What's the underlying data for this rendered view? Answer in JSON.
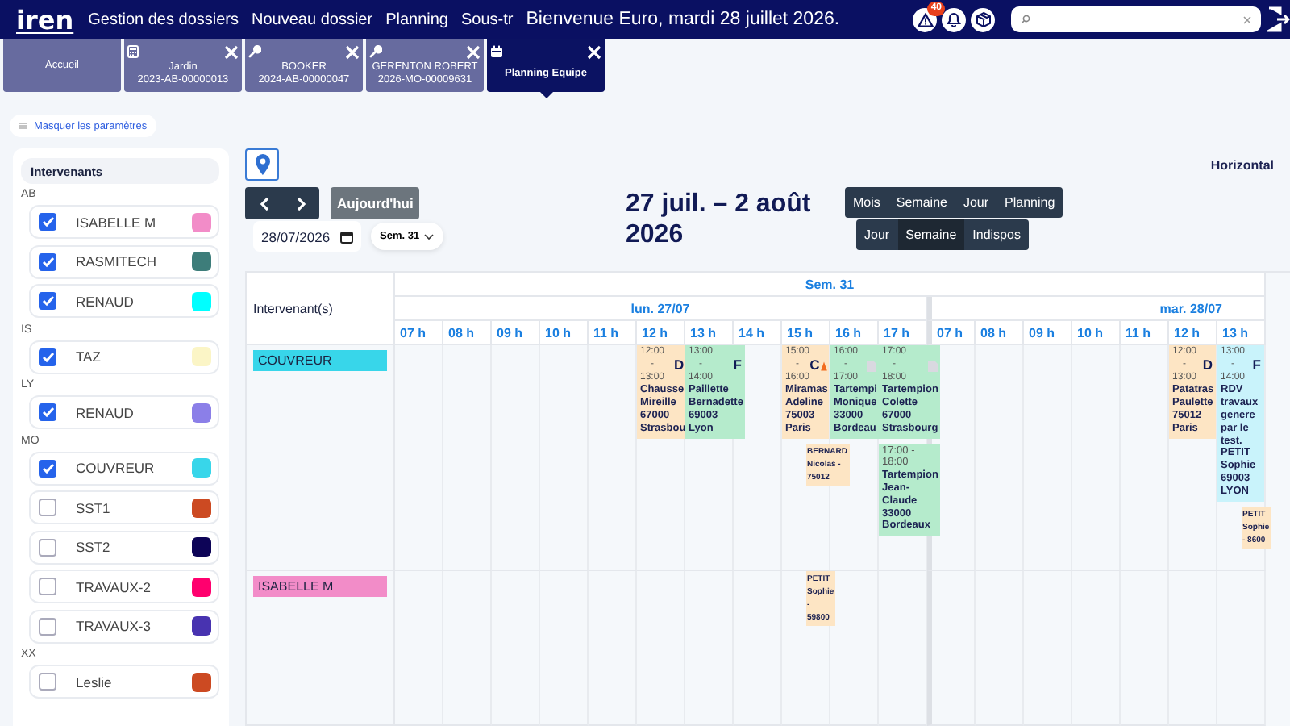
{
  "header": {
    "logo": "iren",
    "nav": [
      {
        "label": "Gestion des dossiers"
      },
      {
        "label": "Nouveau dossier"
      },
      {
        "label": "Planning"
      },
      {
        "label": "Sous-tr"
      }
    ],
    "welcome": "Bienvenue Euro, mardi 28 juillet 2026.",
    "alert_count": "40"
  },
  "tabs": [
    {
      "kind": "home",
      "label": "Accueil",
      "closable": false,
      "selected": false
    },
    {
      "kind": "estimate",
      "label": "Jardin",
      "sublabel": "2023-AB-00000013",
      "closable": true,
      "selected": false
    },
    {
      "kind": "work",
      "label": "BOOKER",
      "sublabel": "2024-AB-00000047",
      "closable": true,
      "selected": false
    },
    {
      "kind": "work",
      "label": "GERENTON ROBERT",
      "sublabel": "2026-MO-00009631",
      "closable": true,
      "selected": false
    },
    {
      "kind": "planning",
      "label": "Planning Equipe",
      "closable": true,
      "selected": true
    }
  ],
  "sidebar": {
    "toggle": "Masquer les paramètres",
    "filter_title": "Intervenants",
    "groups": [
      {
        "label": "AB",
        "items": [
          {
            "name": "ISABELLE M",
            "checked": true,
            "color": "#f28cc8"
          },
          {
            "name": "RASMITECH",
            "checked": true,
            "color": "#3d7d7a"
          },
          {
            "name": "RENAUD",
            "checked": true,
            "color": "#00ffff"
          }
        ]
      },
      {
        "label": "IS",
        "items": [
          {
            "name": "TAZ",
            "checked": true,
            "color": "#fbf5c6"
          }
        ]
      },
      {
        "label": "LY",
        "items": [
          {
            "name": "RENAUD",
            "checked": true,
            "color": "#8b7fe8"
          }
        ]
      },
      {
        "label": "MO",
        "items": [
          {
            "name": "COUVREUR",
            "checked": true,
            "color": "#38d6ea"
          },
          {
            "name": "SST1",
            "checked": false,
            "color": "#cc4a22"
          },
          {
            "name": "SST2",
            "checked": false,
            "color": "#0d0457"
          },
          {
            "name": "TRAVAUX-2",
            "checked": false,
            "color": "#ff006e"
          },
          {
            "name": "TRAVAUX-3",
            "checked": false,
            "color": "#4833b0"
          }
        ]
      },
      {
        "label": "XX",
        "items": [
          {
            "name": "Leslie",
            "checked": false,
            "color": "#cc4a22"
          }
        ]
      }
    ]
  },
  "toolbar": {
    "today": "Aujourd'hui",
    "date": "28/07/2026",
    "week": "Sem. 31",
    "title": "27 juil. – 2 août 2026",
    "views": [
      {
        "label": "Mois",
        "selected": false
      },
      {
        "label": "Semaine",
        "selected": false
      },
      {
        "label": "Jour",
        "selected": false
      },
      {
        "label": "Planning",
        "selected": false
      }
    ],
    "sub_views": [
      {
        "label": "Jour",
        "selected": false
      },
      {
        "label": "Semaine",
        "selected": true
      },
      {
        "label": "Indispos",
        "selected": false
      }
    ],
    "orientation": "Horizontal"
  },
  "calendar": {
    "corner": "Intervenant(s)",
    "week": "Sem. 31",
    "days": [
      {
        "label": "lun. 27/07",
        "hours": [
          "07 h",
          "08 h",
          "09 h",
          "10 h",
          "11 h",
          "12 h",
          "13 h",
          "14 h",
          "15 h",
          "16 h",
          "17 h"
        ]
      },
      {
        "label": "mar. 28/07",
        "hours": [
          "07 h",
          "08 h",
          "09 h",
          "10 h",
          "11 h",
          "12 h",
          "13 h"
        ]
      }
    ],
    "rows": [
      {
        "name": "COUVREUR",
        "color": "#38d6ea",
        "days": [
          {
            "cells": [
              null,
              null,
              null,
              null,
              null,
              {
                "events": [
                  {
                    "kind": "full",
                    "color": "#fde5c4",
                    "time": "12:00 - 13:00",
                    "badge": "D",
                    "text": "Chausse Mireille 67000 Strasbou",
                    "attachment": false,
                    "alert": false
                  }
                ]
              },
              {
                "events": [
                  {
                    "kind": "full",
                    "color": "#b5ebcc",
                    "time": "13:00 - 14:00",
                    "badge": "F",
                    "text": "Paillette Bernadette 69003 Lyon",
                    "attachment": false,
                    "alert": false
                  }
                ]
              },
              null,
              {
                "events": [
                  {
                    "kind": "full",
                    "color": "#fde5c4",
                    "time": "15:00 - 16:00",
                    "badge": "C",
                    "text": "Miramas Adeline 75003 Paris",
                    "attachment": false,
                    "alert": true
                  },
                  {
                    "kind": "compact",
                    "color": "#fde5c4",
                    "text": "BERNARD Nicolas - 75012",
                    "attachment": false,
                    "alert": false
                  }
                ]
              },
              {
                "events": [
                  {
                    "kind": "full",
                    "color": "#b5ebcc",
                    "time": "16:00 - 17:00",
                    "text": "Tartempi Monique 33000 Bordeau",
                    "attachment": true,
                    "alert": false
                  }
                ]
              },
              {
                "events": [
                  {
                    "kind": "full",
                    "color": "#b5ebcc",
                    "time": "17:00 - 18:00",
                    "text": "Tartempion Colette 67000 Strasbourg",
                    "attachment": true,
                    "alert": false
                  },
                  {
                    "kind": "full",
                    "color": "#b5ebcc",
                    "time": "17:00 - 18:00",
                    "text": "Tartempion Jean-Claude 33000 Bordeaux",
                    "attachment": false,
                    "alert": false
                  }
                ]
              }
            ]
          },
          {
            "cells": [
              null,
              null,
              null,
              null,
              null,
              {
                "events": [
                  {
                    "kind": "full",
                    "color": "#fde5c4",
                    "time": "12:00 - 13:00",
                    "badge": "D",
                    "text": "Patatras Paulette 75012 Paris",
                    "attachment": false,
                    "alert": false
                  }
                ]
              },
              {
                "events": [
                  {
                    "kind": "full",
                    "color": "#c9f3fb",
                    "time": "13:00 - 14:00",
                    "badge": "F",
                    "text": "RDV travaux genere par le test. PETIT Sophie 69003 LYON",
                    "attachment": false,
                    "alert": false
                  },
                  {
                    "kind": "compact",
                    "color": "#fde5c4",
                    "text": "PETIT Sophie - 8600",
                    "attachment": false,
                    "alert": false
                  }
                ]
              }
            ]
          }
        ]
      },
      {
        "name": "ISABELLE M",
        "color": "#f28cc8",
        "days": [
          {
            "cells": [
              null,
              null,
              null,
              null,
              null,
              null,
              null,
              null,
              {
                "events": [
                  {
                    "kind": "compact",
                    "color": "#fde5c4",
                    "text": "PETIT Sophie - 59800",
                    "attachment": false,
                    "alert": false
                  }
                ]
              }
            ]
          }
        ]
      }
    ]
  }
}
